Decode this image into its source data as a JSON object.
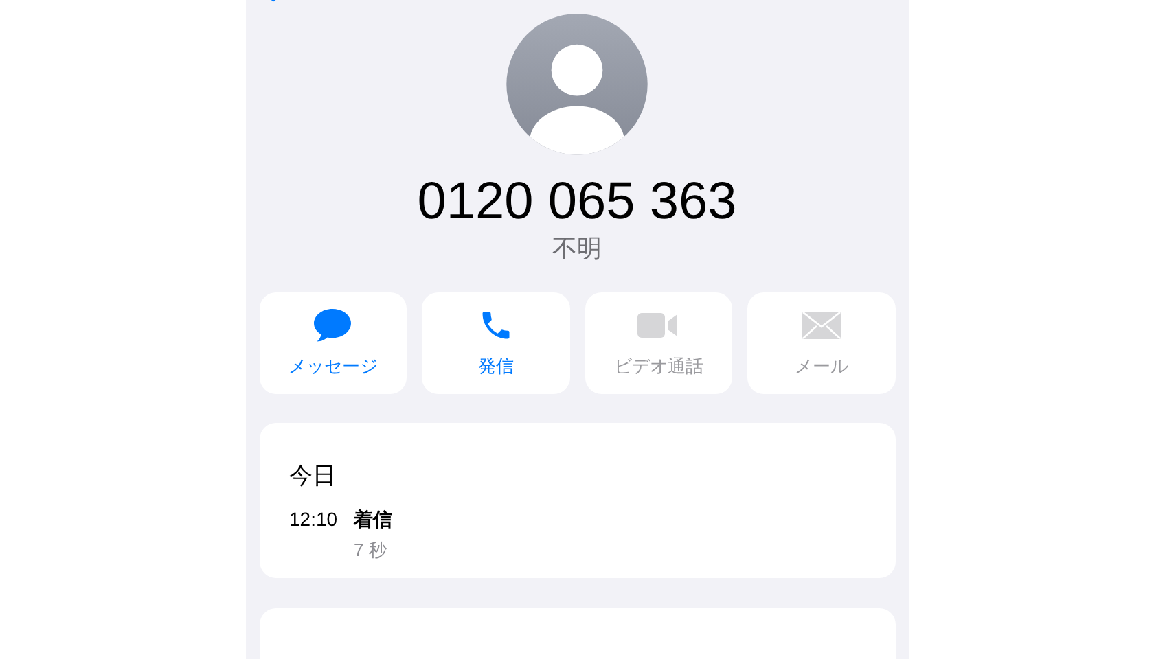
{
  "contact": {
    "number": "0120 065 363",
    "label": "不明"
  },
  "actions": [
    {
      "label": "メッセージ",
      "kind": "message",
      "disabled": false
    },
    {
      "label": "発信",
      "kind": "call",
      "disabled": false
    },
    {
      "label": "ビデオ通話",
      "kind": "video",
      "disabled": true
    },
    {
      "label": "メール",
      "kind": "mail",
      "disabled": true
    }
  ],
  "history": {
    "heading": "今日",
    "entries": [
      {
        "time": "12:10",
        "type": "着信",
        "duration": "7 秒"
      }
    ]
  }
}
